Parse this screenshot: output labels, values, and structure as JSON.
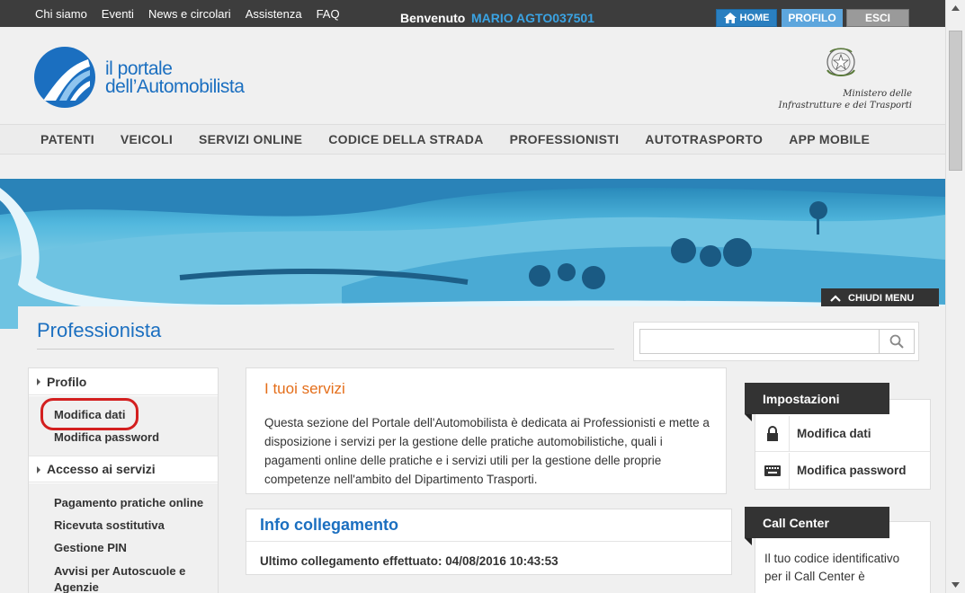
{
  "topbar": {
    "links": [
      "Chi siamo",
      "Eventi",
      "News e circolari",
      "Assistenza",
      "FAQ"
    ],
    "welcome_label": "Benvenuto",
    "user": "MARIO AGTO037501",
    "home_label": "HOME",
    "profilo_label": "PROFILO",
    "esci_label": "ESCI"
  },
  "header": {
    "logo_line1": "il portale",
    "logo_line2": "dell’Automobilista",
    "ministero_line1": "Ministero delle",
    "ministero_line2": "Infrastrutture e dei Trasporti"
  },
  "nav": {
    "items": [
      "PATENTI",
      "VEICOLI",
      "SERVIZI ONLINE",
      "CODICE DELLA STRADA",
      "PROFESSIONISTI",
      "AUTOTRASPORTO",
      "APP MOBILE"
    ]
  },
  "banner": {
    "chiudi_label": "CHIUDI MENU"
  },
  "page": {
    "title": "Professionista"
  },
  "search": {
    "value": "",
    "placeholder": ""
  },
  "sidebar": {
    "profilo_head": "Profilo",
    "profilo_links": [
      "Modifica dati",
      "Modifica password"
    ],
    "accesso_head": "Accesso ai servizi",
    "accesso_links": [
      "Pagamento pratiche online",
      "Ricevuta sostitutiva",
      "Gestione PIN",
      "Avvisi per Autoscuole e Agenzie"
    ]
  },
  "main": {
    "heading": "I tuoi servizi",
    "body": "Questa sezione del Portale dell'Automobilista è dedicata ai Professionisti e mette a disposizione i servizi per la gestione delle pratiche automobilistiche, quali i pagamenti online delle pratiche e i servizi utili per la gestione delle proprie competenze nell'ambito del Dipartimento Trasporti."
  },
  "info": {
    "heading": "Info collegamento",
    "last_login": "Ultimo collegamento effettuato: 04/08/2016 10:43:53"
  },
  "impostazioni": {
    "heading": "Impostazioni",
    "items": [
      {
        "label": "Modifica dati",
        "icon": "lock-icon"
      },
      {
        "label": "Modifica password",
        "icon": "keyboard-icon"
      }
    ]
  },
  "callcenter": {
    "heading": "Call Center",
    "text": "Il tuo codice identificativo per il Call Center è"
  },
  "colors": {
    "brand_blue": "#1b6fc0",
    "accent_orange": "#e46e1a",
    "dark_bar": "#3d3d3d",
    "highlight_red": "#d31f1f"
  }
}
